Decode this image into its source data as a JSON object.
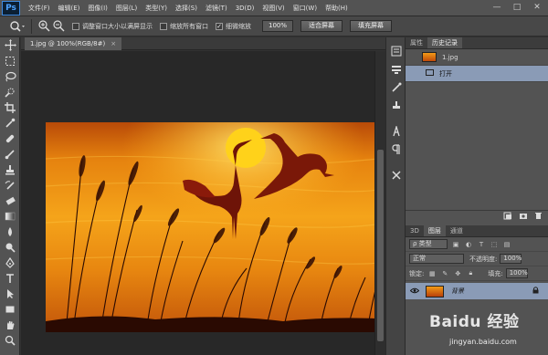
{
  "app": {
    "logo": "Ps"
  },
  "menu": [
    "文件(F)",
    "编辑(E)",
    "图像(I)",
    "图层(L)",
    "类型(Y)",
    "选择(S)",
    "滤镜(T)",
    "3D(D)",
    "视图(V)",
    "窗口(W)",
    "帮助(H)"
  ],
  "window_controls": {
    "minimize": "—",
    "maximize": "□",
    "close": "✕"
  },
  "options": {
    "resize_windows_label": "调整窗口大小以满屏显示",
    "zoom_all_label": "缩放所有窗口",
    "scrubby_zoom_label": "细微缩放",
    "zoom_value": "100%",
    "fit_screen_label": "适合屏幕",
    "fill_screen_label": "填充屏幕"
  },
  "document": {
    "tab_title": "1.jpg @ 100%(RGB/8#)",
    "close": "×"
  },
  "history_panel": {
    "tabs": [
      "属性",
      "历史记录"
    ],
    "snapshot": "1.jpg",
    "states": [
      "打开"
    ]
  },
  "layers_panel": {
    "tabs": [
      "3D",
      "图层",
      "通道"
    ],
    "filter_label": "ρ 类型",
    "blend_mode": "正常",
    "opacity_label": "不透明度:",
    "opacity_value": "100%",
    "lock_label": "锁定:",
    "fill_label": "填充:",
    "fill_value": "100%",
    "layer_name": "背景"
  },
  "watermark": {
    "brand": "Baidu 经验",
    "url": "jingyan.baidu.com"
  },
  "colors": {
    "accent_sun": "#ffd21a",
    "selected_row": "#8a9bb6"
  }
}
